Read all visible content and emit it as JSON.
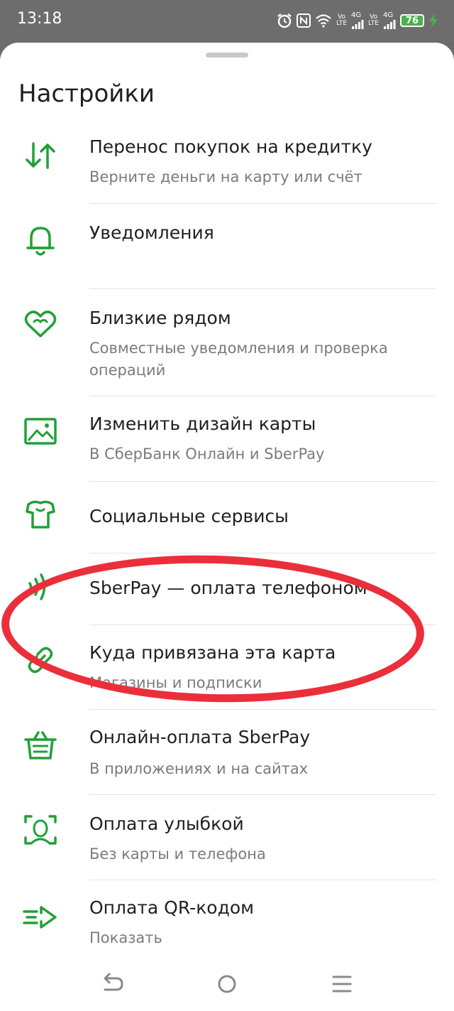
{
  "status_bar": {
    "time": "13:18",
    "net1_top": "Vo",
    "net1_bottom": "LTE",
    "net1_gen": "4G",
    "net2_top": "Vo",
    "net2_bottom": "LTE",
    "net2_gen": "4G",
    "battery": "76"
  },
  "page": {
    "title": "Настройки"
  },
  "items": [
    {
      "title": "Перенос покупок на кредитку",
      "subtitle": "Верните деньги на карту или счёт",
      "icon": "transfer-arrows-icon"
    },
    {
      "title": "Уведомления",
      "subtitle": "",
      "icon": "bell-icon"
    },
    {
      "title": "Близкие рядом",
      "subtitle": "Совместные уведомления и проверка операций",
      "icon": "hearts-icon"
    },
    {
      "title": "Изменить дизайн карты",
      "subtitle": "В СберБанк Онлайн и SberPay",
      "icon": "image-icon"
    },
    {
      "title": "Социальные сервисы",
      "subtitle": "",
      "icon": "social-services-icon"
    },
    {
      "title": "SberPay — оплата телефоном",
      "subtitle": "",
      "icon": "nfc-icon"
    },
    {
      "title": "Куда привязана эта карта",
      "subtitle": "Магазины и подписки",
      "icon": "link-icon"
    },
    {
      "title": "Онлайн-оплата SberPay",
      "subtitle": "В приложениях и на сайтах",
      "icon": "basket-icon"
    },
    {
      "title": "Оплата улыбкой",
      "subtitle": "Без карты и телефона",
      "icon": "face-scan-icon"
    },
    {
      "title": "Оплата QR-кодом",
      "subtitle": "Показать",
      "icon": "qr-arrow-icon"
    }
  ],
  "colors": {
    "accent": "#21a038",
    "highlight": "#ea2f3a"
  }
}
